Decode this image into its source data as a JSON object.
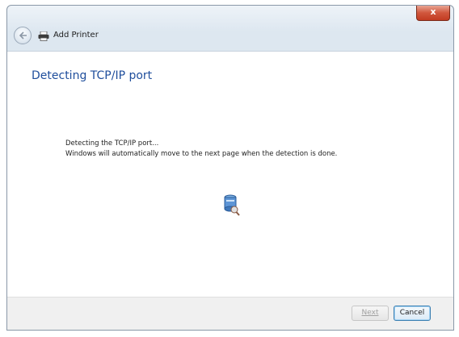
{
  "window": {
    "close_label": "x"
  },
  "navbar": {
    "title": "Add Printer"
  },
  "content": {
    "heading": "Detecting TCP/IP port",
    "line1": "Detecting the TCP/IP port...",
    "line2": "Windows will automatically move to the next page when the detection is done."
  },
  "footer": {
    "next_label": "Next",
    "cancel_label": "Cancel"
  },
  "colors": {
    "heading": "#1f4e9c",
    "close": "#c23b22",
    "cancel_border": "#3c7fb1"
  },
  "icons": [
    "back-arrow-icon",
    "printer-icon",
    "network-search-icon",
    "close-icon"
  ]
}
